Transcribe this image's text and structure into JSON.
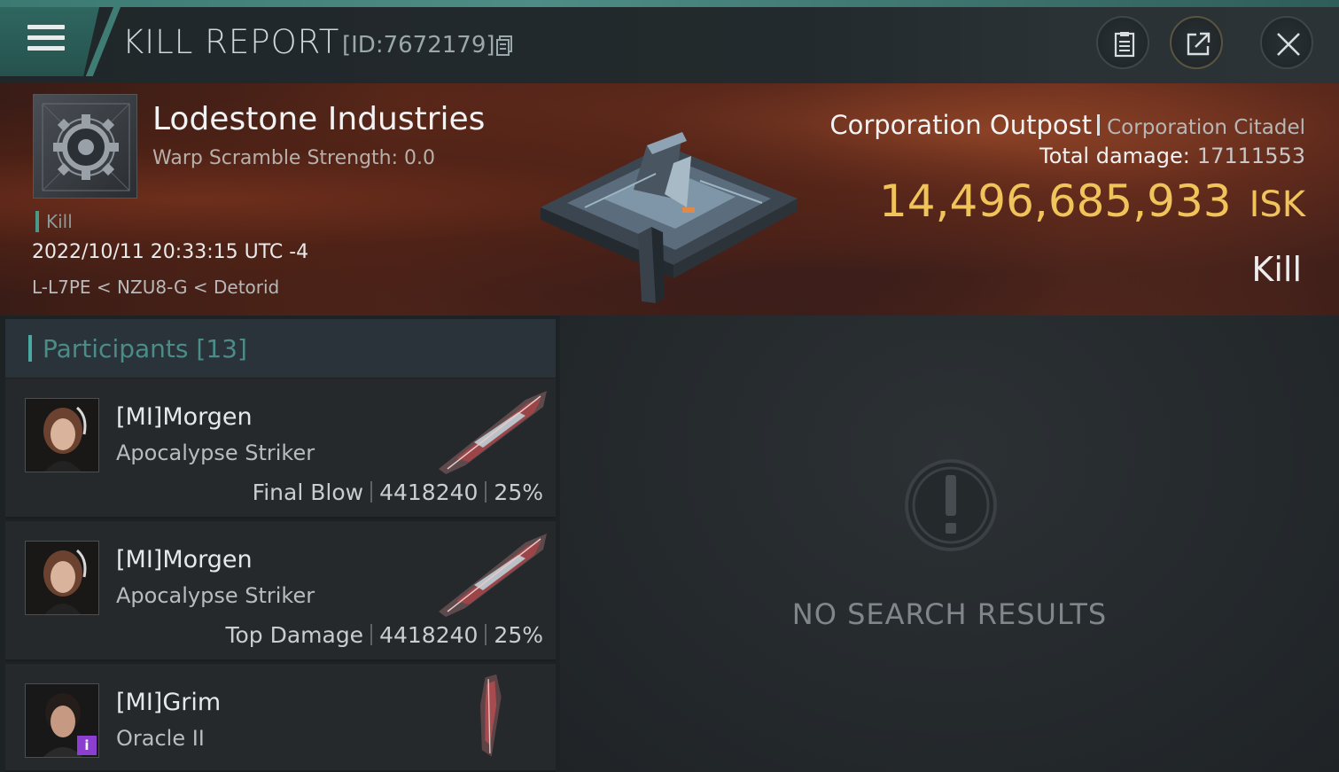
{
  "header": {
    "title": "KILL REPORT",
    "report_id": "[ID:7672179]"
  },
  "victim": {
    "corp_name": "Lodestone Industries",
    "warp_scramble": "Warp Scramble Strength: 0.0",
    "tag": "Kill",
    "timestamp": "2022/10/11 20:33:15 UTC -4",
    "location": "L-L7PE < NZU8-G < Detorid",
    "structure_type": "Corporation Outpost",
    "structure_class": "Corporation Citadel",
    "total_damage_label": "Total damage:",
    "total_damage_value": "17111553",
    "isk_value": "14,496,685,933",
    "isk_unit": "ISK",
    "result": "Kill"
  },
  "participants": {
    "label": "Participants",
    "count": "[13]",
    "items": [
      {
        "name": "[MI]Morgen",
        "ship": "Apocalypse Striker",
        "role": "Final Blow",
        "damage": "4418240",
        "percent": "25%"
      },
      {
        "name": "[MI]Morgen",
        "ship": "Apocalypse Striker",
        "role": "Top Damage",
        "damage": "4418240",
        "percent": "25%"
      },
      {
        "name": "[MI]Grim",
        "ship": "Oracle II",
        "badge": "i"
      }
    ]
  },
  "results": {
    "empty_text": "NO SEARCH RESULTS"
  },
  "colors": {
    "accent_teal": "#4aa9a0",
    "isk_gold": "#f0c45a",
    "badge_purple": "#8a3fd1"
  },
  "icons": {
    "menu": "hamburger-icon",
    "copy": "copy-icon",
    "report": "clipboard-icon",
    "share": "share-icon",
    "close": "close-icon",
    "empty": "exclamation-icon"
  }
}
